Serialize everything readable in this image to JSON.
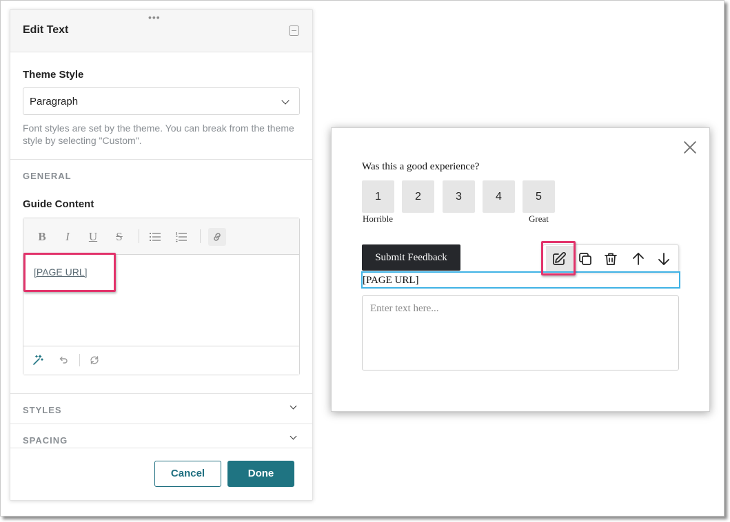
{
  "panel": {
    "title": "Edit Text",
    "drag_handle": "•••",
    "theme_style": {
      "label": "Theme Style",
      "value": "Paragraph",
      "help": "Font styles are set by the theme. You can break from the theme style by selecting \"Custom\"."
    },
    "general": {
      "caption": "GENERAL",
      "guide_content_label": "Guide Content",
      "toolbar": {
        "bold": "B",
        "italic": "I",
        "underline": "U",
        "strike": "S"
      },
      "content_link": "[PAGE URL]"
    },
    "styles_label": "STYLES",
    "spacing_label": "SPACING",
    "cancel_label": "Cancel",
    "done_label": "Done",
    "highlight_color": "#e2336b",
    "accent_color": "#1f7482"
  },
  "modal": {
    "question": "Was this a good experience?",
    "ratings": [
      "1",
      "2",
      "3",
      "4",
      "5"
    ],
    "low_label": "Horrible",
    "high_label": "Great",
    "submit_label": "Submit Feedback",
    "url_text": "[PAGE URL]",
    "textarea_placeholder": "Enter text here...",
    "selection_color": "#3fb2e5"
  }
}
